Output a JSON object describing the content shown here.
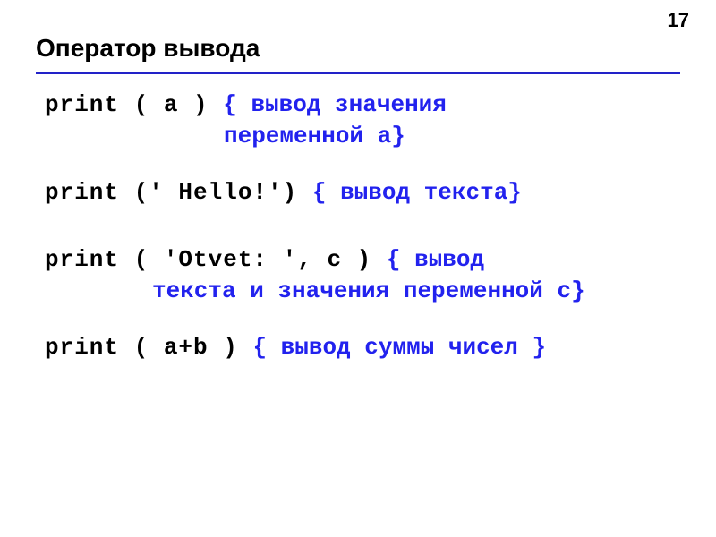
{
  "page_number": "17",
  "title": "Оператор вывода",
  "lines": {
    "l1_code": "print ( a )  ",
    "l1_comment": "{ вывод значения",
    "l1b_comment": "переменной a}",
    "l2_code": "print (' Hello!') ",
    "l2_comment": "{ вывод текста}",
    "l3_code": "print ( 'Otvet: ', c )   ",
    "l3_comment": "{ вывод",
    "l3b_comment": "текста и значения переменной c}",
    "l4_code": "print ( a+b ) ",
    "l4_comment": "{ вывод суммы чисел }"
  }
}
